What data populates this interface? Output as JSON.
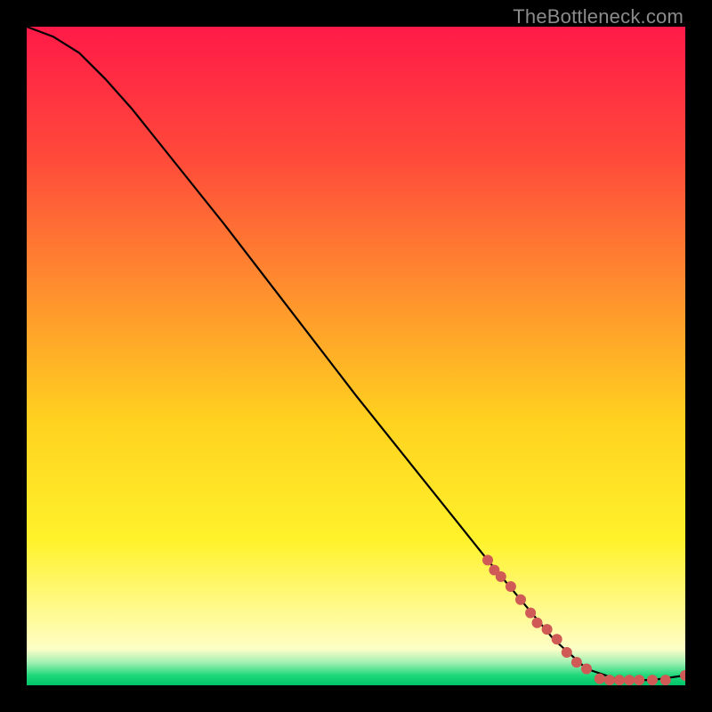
{
  "watermark": "TheBottleneck.com",
  "chart_data": {
    "type": "line",
    "title": "",
    "xlabel": "",
    "ylabel": "",
    "xlim": [
      0,
      100
    ],
    "ylim": [
      0,
      100
    ],
    "grid": false,
    "legend": false,
    "background_gradient": {
      "stops": [
        {
          "offset": 0.0,
          "color": "#ff1a48"
        },
        {
          "offset": 0.2,
          "color": "#ff4a3a"
        },
        {
          "offset": 0.4,
          "color": "#ff8f2e"
        },
        {
          "offset": 0.6,
          "color": "#ffd21f"
        },
        {
          "offset": 0.78,
          "color": "#fff22b"
        },
        {
          "offset": 0.9,
          "color": "#fffb9b"
        },
        {
          "offset": 0.945,
          "color": "#fdfec6"
        },
        {
          "offset": 0.965,
          "color": "#a2f0b3"
        },
        {
          "offset": 0.985,
          "color": "#1fd87a"
        },
        {
          "offset": 1.0,
          "color": "#00c46a"
        }
      ]
    },
    "series": [
      {
        "name": "bottleneck-curve",
        "color": "#000000",
        "x": [
          0,
          4,
          8,
          12,
          16,
          20,
          30,
          40,
          50,
          60,
          70,
          75,
          80,
          85,
          90,
          95,
          100
        ],
        "y": [
          100,
          98.5,
          96,
          92,
          87.5,
          82.5,
          70,
          57,
          44,
          31.5,
          19,
          13,
          7,
          2.5,
          0.8,
          0.8,
          1.5
        ]
      }
    ],
    "markers": {
      "name": "highlight-points",
      "color": "#d05a55",
      "points": [
        {
          "x": 70,
          "y": 19
        },
        {
          "x": 71,
          "y": 17.5
        },
        {
          "x": 72,
          "y": 16.5
        },
        {
          "x": 73.5,
          "y": 15
        },
        {
          "x": 75,
          "y": 13
        },
        {
          "x": 76.5,
          "y": 11
        },
        {
          "x": 77.5,
          "y": 9.5
        },
        {
          "x": 79,
          "y": 8.5
        },
        {
          "x": 80.5,
          "y": 7
        },
        {
          "x": 82,
          "y": 5
        },
        {
          "x": 83.5,
          "y": 3.5
        },
        {
          "x": 85,
          "y": 2.5
        },
        {
          "x": 87,
          "y": 1
        },
        {
          "x": 88.5,
          "y": 0.8
        },
        {
          "x": 90,
          "y": 0.8
        },
        {
          "x": 91.5,
          "y": 0.8
        },
        {
          "x": 93,
          "y": 0.8
        },
        {
          "x": 95,
          "y": 0.8
        },
        {
          "x": 97,
          "y": 0.8
        },
        {
          "x": 100,
          "y": 1.5
        }
      ]
    }
  }
}
